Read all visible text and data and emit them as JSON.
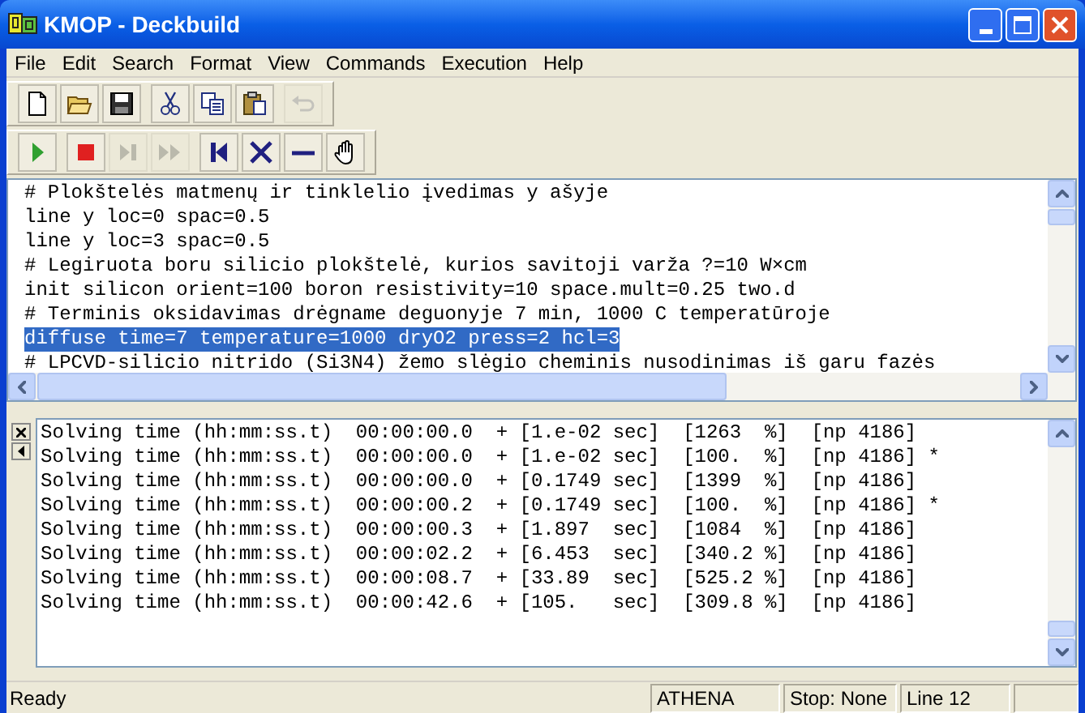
{
  "window": {
    "title": "KMOP - Deckbuild"
  },
  "menu": [
    "File",
    "Edit",
    "Search",
    "Format",
    "View",
    "Commands",
    "Execution",
    "Help"
  ],
  "toolbars": [
    {
      "groups": [
        [
          {
            "kind": "new",
            "disabled": false
          },
          {
            "kind": "open",
            "disabled": false
          },
          {
            "kind": "save",
            "disabled": false
          }
        ],
        [
          {
            "kind": "cut",
            "disabled": false
          },
          {
            "kind": "copy",
            "disabled": false
          },
          {
            "kind": "paste",
            "disabled": false
          }
        ],
        [
          {
            "kind": "undo",
            "disabled": true
          }
        ]
      ]
    },
    {
      "groups": [
        [
          {
            "kind": "run",
            "disabled": false
          }
        ],
        [
          {
            "kind": "stop",
            "disabled": false
          },
          {
            "kind": "step",
            "disabled": true
          },
          {
            "kind": "fast-forward",
            "disabled": true
          }
        ],
        [
          {
            "kind": "rewind",
            "disabled": false
          },
          {
            "kind": "kill",
            "disabled": false
          },
          {
            "kind": "line",
            "disabled": false
          },
          {
            "kind": "pause",
            "disabled": false
          }
        ]
      ]
    }
  ],
  "editor": {
    "lines": [
      {
        "text": "# Plokštelės matmenų ir tinklelio įvedimas y ašyje",
        "selected": false
      },
      {
        "text": "line y loc=0 spac=0.5",
        "selected": false
      },
      {
        "text": "line y loc=3 spac=0.5",
        "selected": false
      },
      {
        "text": "# Legiruota boru silicio plokštelė, kurios savitoji varža ?=10 W×cm",
        "selected": false
      },
      {
        "text": "init silicon orient=100 boron resistivity=10 space.mult=0.25 two.d",
        "selected": false
      },
      {
        "text": "# Terminis oksidavimas drėgname deguonyje 7 min, 1000 C temperatūroje",
        "selected": false
      },
      {
        "text": "diffuse time=7 temperature=1000 dryO2 press=2 hcl=3",
        "selected": true
      },
      {
        "text": "# LPCVD-silicio nitrido (Si3N4) žemo slėgio cheminis nusodinimas iš garu fazės",
        "selected": false
      }
    ]
  },
  "output": {
    "lines": [
      "Solving time (hh:mm:ss.t)  00:00:00.0  + [1.e-02 sec]  [1263  %]  [np 4186]",
      "Solving time (hh:mm:ss.t)  00:00:00.0  + [1.e-02 sec]  [100.  %]  [np 4186] *",
      "Solving time (hh:mm:ss.t)  00:00:00.0  + [0.1749 sec]  [1399  %]  [np 4186]",
      "Solving time (hh:mm:ss.t)  00:00:00.2  + [0.1749 sec]  [100.  %]  [np 4186] *",
      "Solving time (hh:mm:ss.t)  00:00:00.3  + [1.897  sec]  [1084  %]  [np 4186]",
      "Solving time (hh:mm:ss.t)  00:00:02.2  + [6.453  sec]  [340.2 %]  [np 4186]",
      "Solving time (hh:mm:ss.t)  00:00:08.7  + [33.89  sec]  [525.2 %]  [np 4186]",
      "Solving time (hh:mm:ss.t)  00:00:42.6  + [105.   sec]  [309.8 %]  [np 4186]"
    ]
  },
  "status_bar": {
    "message": "Ready",
    "panes": [
      "ATHENA",
      "Stop: None",
      "Line 12"
    ]
  }
}
